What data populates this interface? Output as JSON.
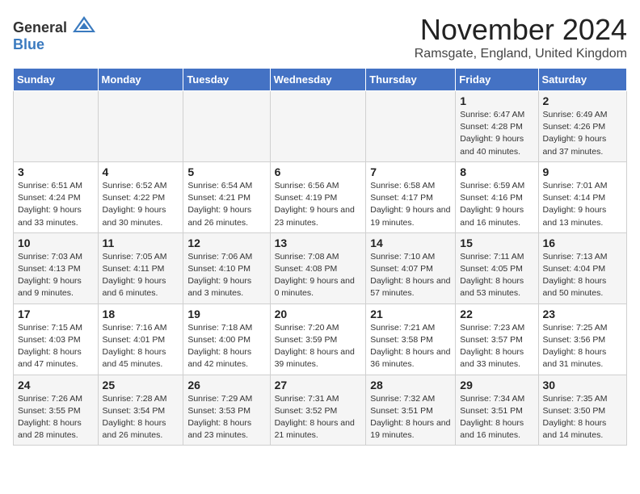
{
  "logo": {
    "general": "General",
    "blue": "Blue"
  },
  "title": {
    "month": "November 2024",
    "location": "Ramsgate, England, United Kingdom"
  },
  "headers": [
    "Sunday",
    "Monday",
    "Tuesday",
    "Wednesday",
    "Thursday",
    "Friday",
    "Saturday"
  ],
  "weeks": [
    [
      {
        "day": "",
        "info": ""
      },
      {
        "day": "",
        "info": ""
      },
      {
        "day": "",
        "info": ""
      },
      {
        "day": "",
        "info": ""
      },
      {
        "day": "",
        "info": ""
      },
      {
        "day": "1",
        "info": "Sunrise: 6:47 AM\nSunset: 4:28 PM\nDaylight: 9 hours and 40 minutes."
      },
      {
        "day": "2",
        "info": "Sunrise: 6:49 AM\nSunset: 4:26 PM\nDaylight: 9 hours and 37 minutes."
      }
    ],
    [
      {
        "day": "3",
        "info": "Sunrise: 6:51 AM\nSunset: 4:24 PM\nDaylight: 9 hours and 33 minutes."
      },
      {
        "day": "4",
        "info": "Sunrise: 6:52 AM\nSunset: 4:22 PM\nDaylight: 9 hours and 30 minutes."
      },
      {
        "day": "5",
        "info": "Sunrise: 6:54 AM\nSunset: 4:21 PM\nDaylight: 9 hours and 26 minutes."
      },
      {
        "day": "6",
        "info": "Sunrise: 6:56 AM\nSunset: 4:19 PM\nDaylight: 9 hours and 23 minutes."
      },
      {
        "day": "7",
        "info": "Sunrise: 6:58 AM\nSunset: 4:17 PM\nDaylight: 9 hours and 19 minutes."
      },
      {
        "day": "8",
        "info": "Sunrise: 6:59 AM\nSunset: 4:16 PM\nDaylight: 9 hours and 16 minutes."
      },
      {
        "day": "9",
        "info": "Sunrise: 7:01 AM\nSunset: 4:14 PM\nDaylight: 9 hours and 13 minutes."
      }
    ],
    [
      {
        "day": "10",
        "info": "Sunrise: 7:03 AM\nSunset: 4:13 PM\nDaylight: 9 hours and 9 minutes."
      },
      {
        "day": "11",
        "info": "Sunrise: 7:05 AM\nSunset: 4:11 PM\nDaylight: 9 hours and 6 minutes."
      },
      {
        "day": "12",
        "info": "Sunrise: 7:06 AM\nSunset: 4:10 PM\nDaylight: 9 hours and 3 minutes."
      },
      {
        "day": "13",
        "info": "Sunrise: 7:08 AM\nSunset: 4:08 PM\nDaylight: 9 hours and 0 minutes."
      },
      {
        "day": "14",
        "info": "Sunrise: 7:10 AM\nSunset: 4:07 PM\nDaylight: 8 hours and 57 minutes."
      },
      {
        "day": "15",
        "info": "Sunrise: 7:11 AM\nSunset: 4:05 PM\nDaylight: 8 hours and 53 minutes."
      },
      {
        "day": "16",
        "info": "Sunrise: 7:13 AM\nSunset: 4:04 PM\nDaylight: 8 hours and 50 minutes."
      }
    ],
    [
      {
        "day": "17",
        "info": "Sunrise: 7:15 AM\nSunset: 4:03 PM\nDaylight: 8 hours and 47 minutes."
      },
      {
        "day": "18",
        "info": "Sunrise: 7:16 AM\nSunset: 4:01 PM\nDaylight: 8 hours and 45 minutes."
      },
      {
        "day": "19",
        "info": "Sunrise: 7:18 AM\nSunset: 4:00 PM\nDaylight: 8 hours and 42 minutes."
      },
      {
        "day": "20",
        "info": "Sunrise: 7:20 AM\nSunset: 3:59 PM\nDaylight: 8 hours and 39 minutes."
      },
      {
        "day": "21",
        "info": "Sunrise: 7:21 AM\nSunset: 3:58 PM\nDaylight: 8 hours and 36 minutes."
      },
      {
        "day": "22",
        "info": "Sunrise: 7:23 AM\nSunset: 3:57 PM\nDaylight: 8 hours and 33 minutes."
      },
      {
        "day": "23",
        "info": "Sunrise: 7:25 AM\nSunset: 3:56 PM\nDaylight: 8 hours and 31 minutes."
      }
    ],
    [
      {
        "day": "24",
        "info": "Sunrise: 7:26 AM\nSunset: 3:55 PM\nDaylight: 8 hours and 28 minutes."
      },
      {
        "day": "25",
        "info": "Sunrise: 7:28 AM\nSunset: 3:54 PM\nDaylight: 8 hours and 26 minutes."
      },
      {
        "day": "26",
        "info": "Sunrise: 7:29 AM\nSunset: 3:53 PM\nDaylight: 8 hours and 23 minutes."
      },
      {
        "day": "27",
        "info": "Sunrise: 7:31 AM\nSunset: 3:52 PM\nDaylight: 8 hours and 21 minutes."
      },
      {
        "day": "28",
        "info": "Sunrise: 7:32 AM\nSunset: 3:51 PM\nDaylight: 8 hours and 19 minutes."
      },
      {
        "day": "29",
        "info": "Sunrise: 7:34 AM\nSunset: 3:51 PM\nDaylight: 8 hours and 16 minutes."
      },
      {
        "day": "30",
        "info": "Sunrise: 7:35 AM\nSunset: 3:50 PM\nDaylight: 8 hours and 14 minutes."
      }
    ]
  ]
}
